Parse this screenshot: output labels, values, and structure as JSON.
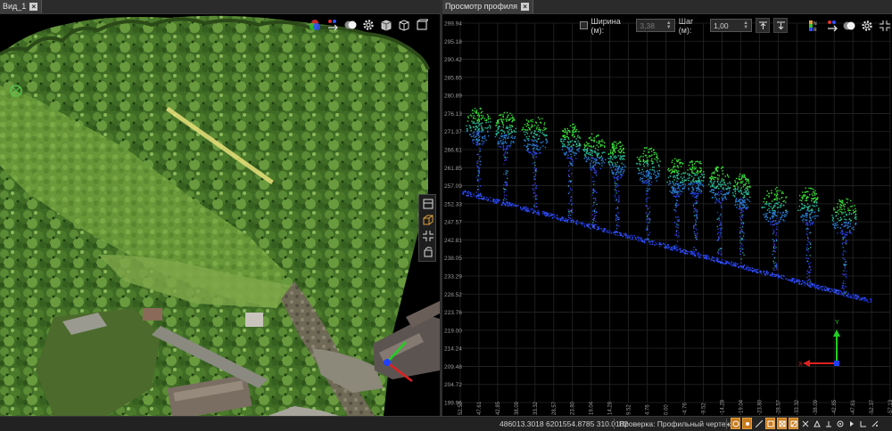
{
  "left_view": {
    "tab_label": "Вид_1",
    "toolbar_icons": [
      "color-wheel-icon",
      "swap-arrows-icon",
      "shading-spheres-icon",
      "settings-gear-icon",
      "cube-solid-icon",
      "cube-wire-icon",
      "box-outline-icon"
    ],
    "side_icons": [
      "view-top-icon",
      "view-3d-cube-icon",
      "corner-brackets-icon",
      "rotate-icon"
    ],
    "axes": {
      "x": "X",
      "y": "Y",
      "z": "Z"
    }
  },
  "profile_view": {
    "tab_label": "Просмотр профиля",
    "width_label": "Ширина (м):",
    "width_value": "3,38",
    "step_label": "Шаг (м):",
    "step_value": "1,00",
    "y_ticks": [
      "299.94",
      "295.18",
      "290.42",
      "285.65",
      "280.89",
      "276.13",
      "271.37",
      "266.61",
      "261.85",
      "257.09",
      "252.33",
      "247.57",
      "242.81",
      "238.05",
      "233.29",
      "228.52",
      "223.76",
      "219.00",
      "214.24",
      "209.48",
      "204.72",
      "199.96"
    ],
    "x_ticks": [
      "52.57",
      "47.61",
      "42.85",
      "38.09",
      "33.32",
      "28.57",
      "23.80",
      "19.04",
      "14.28",
      "9.52",
      "4.76",
      "0.00",
      "-4.76",
      "-9.52",
      "-14.28",
      "-19.04",
      "-23.80",
      "-28.57",
      "-33.32",
      "-38.09",
      "-42.85",
      "-47.61",
      "-52.37",
      "-57.13"
    ],
    "axes": {
      "x": "X",
      "y": "Y"
    }
  },
  "status_bar": {
    "coordinates": "486013.3018 6201554.8785 310.0182",
    "status_text": "Проверка: Профильный чертеж"
  },
  "colors": {
    "background": "#000000",
    "panel": "#2b2b2b",
    "grid": "#262626",
    "axis_x": "#e02020",
    "axis_y": "#20d020",
    "axis_z": "#2040ff",
    "highlight": "#e8e07a",
    "accent_orange": "#c97a1c"
  }
}
